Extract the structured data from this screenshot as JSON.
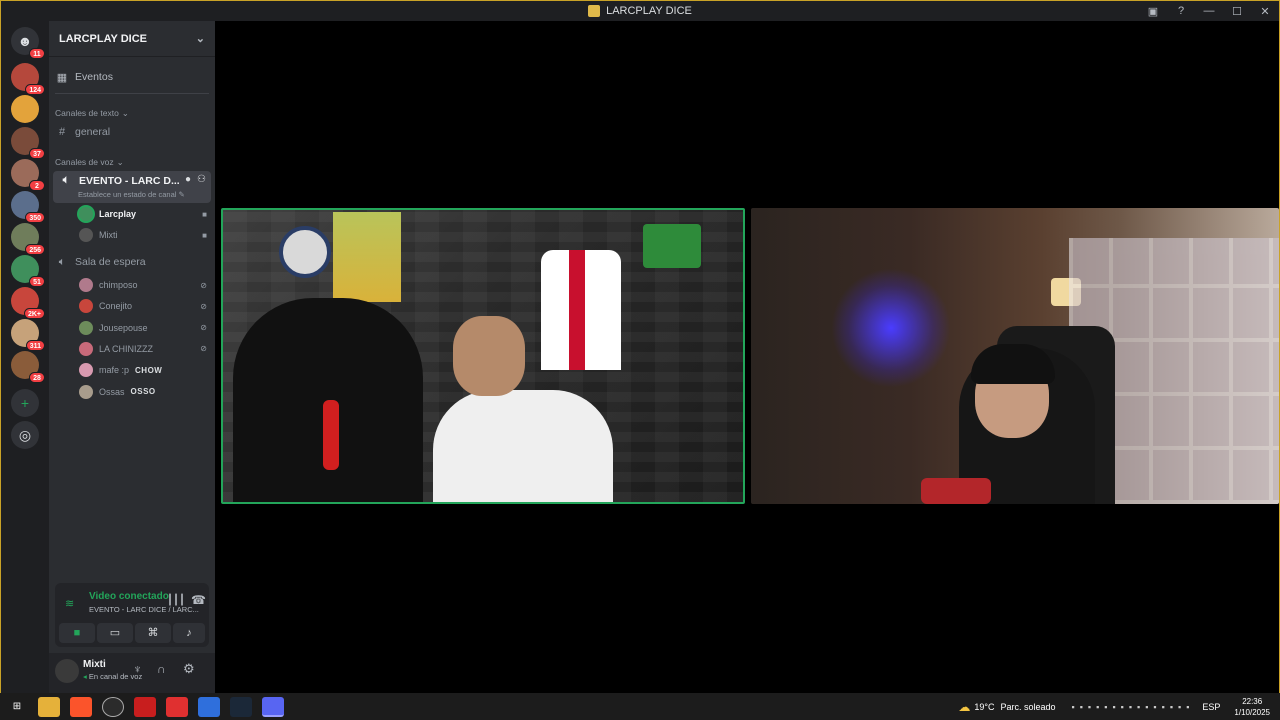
{
  "window": {
    "title": "LARCPLAY DICE"
  },
  "rail": {
    "dm_badge": "11",
    "servers": [
      {
        "badge": "124",
        "color": "#b5483c"
      },
      {
        "badge": "",
        "color": "#e3a33b"
      },
      {
        "badge": "37",
        "color": "#7a4b3a"
      },
      {
        "badge": "2",
        "color": "#9b6b5a"
      },
      {
        "badge": "350",
        "color": "#5b6e8c"
      },
      {
        "badge": "256",
        "color": "#6f7d5b"
      },
      {
        "badge": "51",
        "color": "#3f8f5c"
      },
      {
        "badge": "2K+",
        "color": "#c8463c"
      },
      {
        "badge": "311",
        "color": "#c6a27a"
      },
      {
        "badge": "28",
        "color": "#8a5c3a"
      }
    ]
  },
  "sidebar": {
    "guild_name": "LARCPLAY DICE",
    "events_label": "Eventos",
    "text_category": "Canales de texto",
    "text_channel": "general",
    "voice_category": "Canales de voz",
    "active_voice_channel": "EVENTO - LARC D...",
    "status_hint": "Establece un estado de canal",
    "voice_users": [
      {
        "name": "Larcplay",
        "color": "#3f8f5c"
      },
      {
        "name": "Mixti",
        "color": "#555"
      }
    ],
    "waiting_room": "Sala de espera",
    "waiting_users": [
      {
        "name": "chimposo",
        "tag": "",
        "color": "#b07a8c"
      },
      {
        "name": "Conejito",
        "tag": "",
        "color": "#c8463c"
      },
      {
        "name": "Jousepouse",
        "tag": "",
        "color": "#6d8c5b"
      },
      {
        "name": "LA CHINIZZZ",
        "tag": "",
        "color": "#c86a7a"
      },
      {
        "name": "mafe :p",
        "tag": "CHOW",
        "color": "#d89ab0"
      },
      {
        "name": "Ossas",
        "tag": "OSSO",
        "color": "#a89c8c"
      }
    ]
  },
  "voice_panel": {
    "status": "Video conectado",
    "channel": "EVENTO - LARC DICE / LARC..."
  },
  "user_panel": {
    "name": "Mixti",
    "status": "En canal de voz"
  },
  "taskbar": {
    "weather_temp": "19°C",
    "weather_desc": "Parc. soleado",
    "lang": "ESP",
    "time": "22:36",
    "date": "1/10/2025"
  },
  "colors": {
    "accent_green": "#23a55a",
    "badge_red": "#f23f43",
    "frame_gold": "#c9a227"
  }
}
